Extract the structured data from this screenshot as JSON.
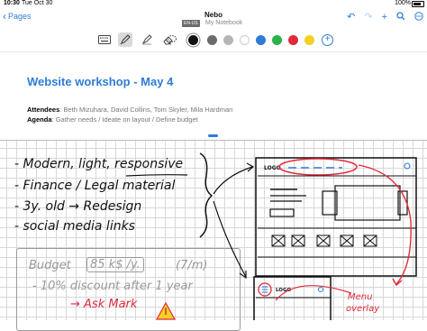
{
  "status_bar": {
    "time": "10:30",
    "date": "Tue Oct 30",
    "battery": "100%"
  },
  "nav": {
    "back_label": "Pages",
    "title": "Nebo",
    "lang_badge": "EN-US",
    "subtitle": "My Notebook"
  },
  "toolbar": {
    "tools": [
      "keyboard-tool",
      "pen-tool",
      "highlighter-tool",
      "eraser-tool",
      "lasso-tool"
    ],
    "selected_tool": "pen-tool",
    "colors": [
      "#111111",
      "#6b6b6b",
      "#b5b5b5",
      "#ffffff",
      "#2f7bd6",
      "#29b34a",
      "#e02a3a",
      "#f2d024"
    ],
    "selected_color": "#111111"
  },
  "document": {
    "heading": "Website workshop - May 4",
    "attendees_label": "Attendees",
    "attendees_value": ": Beth Mizuhara, David Collins, Tom Skyler, Mila Hardman",
    "agenda_label": "Agenda",
    "agenda_value": ": Gather needs / Ideate on layout / Define budget"
  },
  "handwriting": {
    "list": [
      "- Modern, light, responsive",
      "- Finance / Legal material",
      "- 3y. old → Redesign",
      "- social media links"
    ],
    "budget_label": "Budget",
    "budget_value": "85 k$ /y.",
    "budget_monthly": "(7/m)",
    "discount": "- 10% discount after 1 year",
    "ask": "→ Ask Mark",
    "sketch_logo_1": "LOGO",
    "sketch_logo_2": "LOGO",
    "menu_note_1": "Menu",
    "menu_note_2": "overlay"
  }
}
